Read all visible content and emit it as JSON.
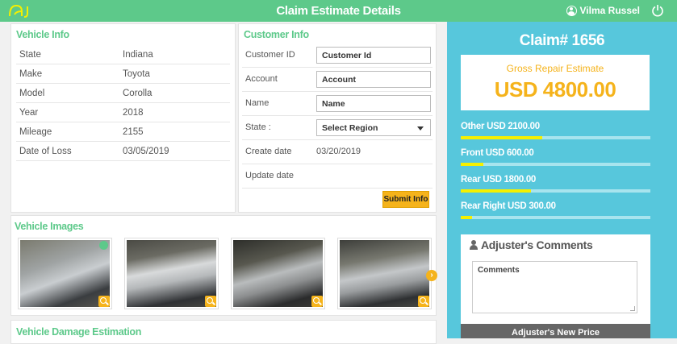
{
  "topbar": {
    "title": "Claim Estimate Details",
    "user_name": "Vilma Russel",
    "logo_icon": "aj-logo",
    "power_icon": "power-icon"
  },
  "vehicle_info": {
    "title": "Vehicle Info",
    "rows": [
      {
        "label": "State",
        "value": "Indiana"
      },
      {
        "label": "Make",
        "value": "Toyota"
      },
      {
        "label": "Model",
        "value": "Corolla"
      },
      {
        "label": "Year",
        "value": "2018"
      },
      {
        "label": "Mileage",
        "value": "2155"
      },
      {
        "label": "Date of Loss",
        "value": "03/05/2019"
      }
    ]
  },
  "customer_info": {
    "title": "Customer Info",
    "customer_id": {
      "label": "Customer ID",
      "value": "Customer Id"
    },
    "account": {
      "label": "Account",
      "value": "Account"
    },
    "name": {
      "label": "Name",
      "value": "Name"
    },
    "state": {
      "label": "State :",
      "value": "Select Region"
    },
    "create_date": {
      "label": "Create date",
      "value": "03/20/2019"
    },
    "update_date": {
      "label": "Update date",
      "value": ""
    },
    "submit_label": "Submit Info"
  },
  "vehicle_images": {
    "title": "Vehicle Images",
    "count": 4
  },
  "damage_estimation": {
    "title": "Vehicle Damage Estimation"
  },
  "summary": {
    "claim_label": "Claim# 1656",
    "gross_label": "Gross Repair Estimate",
    "gross_amount": "USD 4800.00",
    "bars": [
      {
        "label": "Other USD 2100.00",
        "fraction": 0.43
      },
      {
        "label": "Front USD 600.00",
        "fraction": 0.12
      },
      {
        "label": "Rear USD 1800.00",
        "fraction": 0.37
      },
      {
        "label": "Rear Right USD 300.00",
        "fraction": 0.06
      }
    ],
    "comments_title": "Adjuster's Comments",
    "comments_placeholder": "Comments",
    "new_price_label": "Adjuster's New Price"
  },
  "colors": {
    "accent": "#5dc98a",
    "summary_bg": "#57c7dc",
    "highlight": "#f5b31b",
    "bar_fill": "#f5f000"
  }
}
